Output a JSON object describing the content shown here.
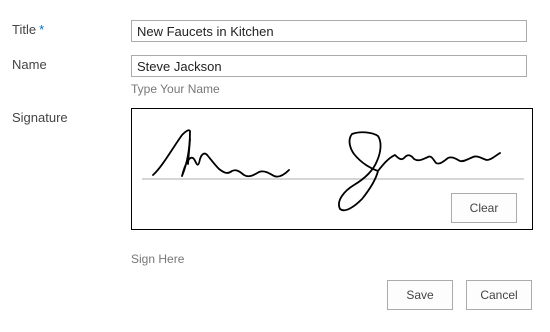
{
  "form": {
    "title": {
      "label": "Title",
      "required_marker": "*",
      "value": "New Faucets in Kitchen"
    },
    "name": {
      "label": "Name",
      "value": "Steve Jackson",
      "hint": "Type Your Name"
    },
    "signature": {
      "label": "Signature",
      "clear_label": "Clear",
      "hint": "Sign Here"
    }
  },
  "actions": {
    "save_label": "Save",
    "cancel_label": "Cancel"
  },
  "colors": {
    "required": "#0072c6",
    "border": "#ababab",
    "ink": "#000000"
  }
}
